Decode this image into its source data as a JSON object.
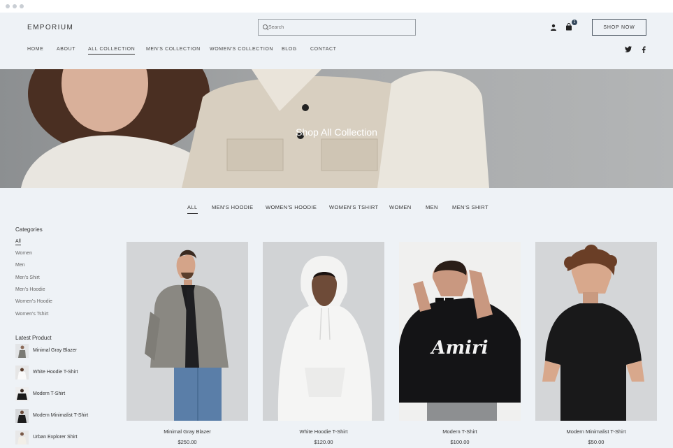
{
  "header": {
    "logo": "EMPORIUM",
    "search_placeholder": "Search",
    "cart_count": "1",
    "cta_label": "SHOP NOW",
    "nav": [
      "HOME",
      "ABOUT",
      "ALL COLLECTION",
      "MEN'S COLLECTION",
      "WOMEN'S COLLECTION",
      "BLOG",
      "CONTACT"
    ],
    "active_nav": "ALL COLLECTION"
  },
  "hero": {
    "title": "Shop All Collection"
  },
  "filters": {
    "items": [
      "ALL",
      "MEN'S HOODIE",
      "WOMEN'S HOODIE",
      "WOMEN'S TSHIRT",
      "WOMEN",
      "MEN",
      "MEN'S SHIRT"
    ],
    "active": "ALL"
  },
  "sidebar": {
    "categories_heading": "Categories",
    "categories": [
      "All",
      "Women",
      "Men",
      "Men's Shirt",
      "Men's Hoodie",
      "Women's Hoodie",
      "Women's Tshirt"
    ],
    "latest_heading": "Latest Product",
    "latest": [
      "Minimal Gray Blazer",
      "White Hoodie T-Shirt",
      "Modern T-Shirt",
      "Modern Minimalist T-Shirt",
      "Urban Explorer Shirt"
    ]
  },
  "products": [
    {
      "name": "Minimal Gray Blazer",
      "price": "$250.00"
    },
    {
      "name": "White Hoodie T-Shirt",
      "price": "$120.00"
    },
    {
      "name": "Modern T-Shirt",
      "price": "$100.00"
    },
    {
      "name": "Modern Minimalist T-Shirt",
      "price": "$50.00"
    }
  ],
  "colors": {
    "background": "#eef2f6",
    "text": "#333333",
    "accent": "#33475b"
  }
}
